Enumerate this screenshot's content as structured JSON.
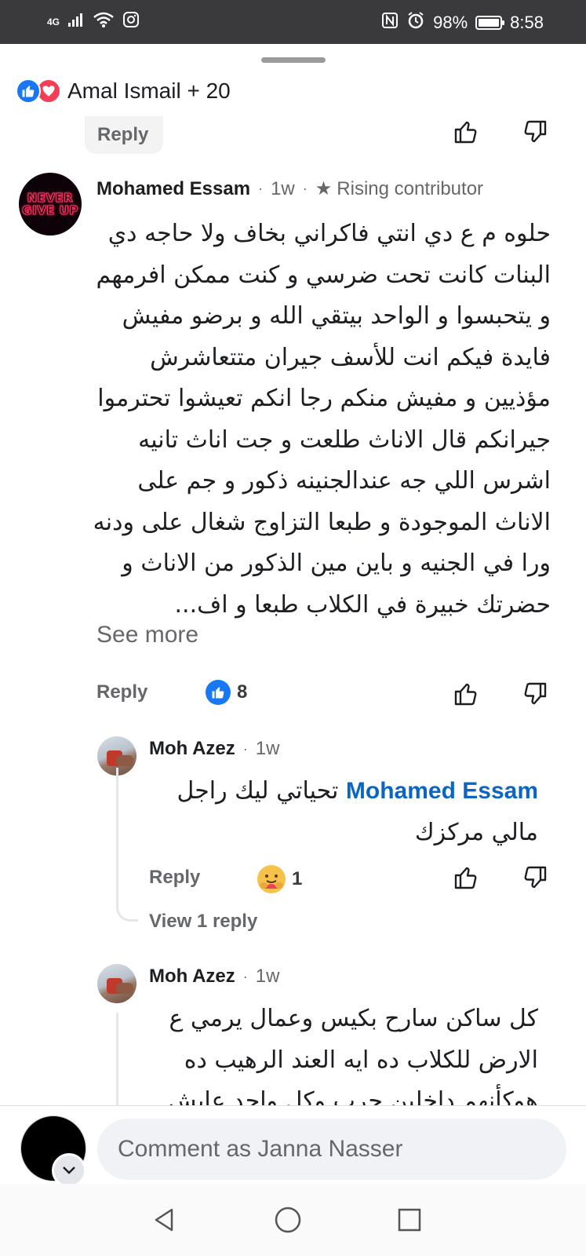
{
  "status_bar": {
    "network": "4G",
    "battery": "98%",
    "time": "8:58"
  },
  "reactions_summary": {
    "text": "Amal Ismail + 20"
  },
  "top_reply_label": "Reply",
  "comment_main": {
    "author": "Mohamed Essam",
    "time": "1w",
    "badge": "Rising contributor",
    "avatar_text": [
      "NEVER",
      "GIVE UP"
    ],
    "body": "حلوه م ع دي انتي فاكراني بخاف ولا حاجه دي البنات كانت تحت ضرسي و كنت ممكن افرمهم و يتحبسوا و الواحد بيتقي الله و برضو مفيش فايدة فيكم انت للأسف جيران متتعاشرش مؤذيين و مفيش منكم رجا انكم تعيشوا تحترموا جيرانكم قال الاناث طلعت و جت اناث تانيه اشرس اللي جه عندالجنينه ذكور و جم على الاناث الموجودة و طبعا التزاوج شغال على ودنه ورا في الجنيه و باين مين الذكور من الاناث و حضرتك خبيرة في الكلاب طبعا و اف...",
    "see_more": "See more",
    "reply": "Reply",
    "reaction_count": "8"
  },
  "reply_1": {
    "author": "Moh Azez",
    "time": "1w",
    "mention": "Mohamed Essam",
    "body_after_mention": " تحياتي ليك راجل مالي مركزك",
    "reply": "Reply",
    "reaction_count": "1",
    "view_replies": "View 1 reply"
  },
  "reply_2": {
    "author": "Moh Azez",
    "time": "1w",
    "body": "كل ساكن سارح بكيس وعمال يرمي ع الارض للكلاب ده ايه العند الرهيب ده هوكأنهم داخلين حرب وكل واحد عايش"
  },
  "composer": {
    "placeholder": "Comment as Janna Nasser"
  },
  "icons": {
    "signal": "signal-icon",
    "wifi": "wifi-icon",
    "nfc": "nfc-icon",
    "alarm": "alarm-icon",
    "like": "like-icon",
    "love": "love-icon",
    "care": "care-icon",
    "thumbs_up": "thumbs-up-icon",
    "thumbs_down": "thumbs-down-icon",
    "star": "star-icon",
    "chevron": "chevron-down-icon",
    "back": "back-icon",
    "home": "home-icon",
    "recents": "recents-icon"
  },
  "colors": {
    "accent_blue": "#1877f2",
    "mention_blue": "#0a66c2",
    "love_red": "#f33e58",
    "secondary_text": "#65676b"
  }
}
